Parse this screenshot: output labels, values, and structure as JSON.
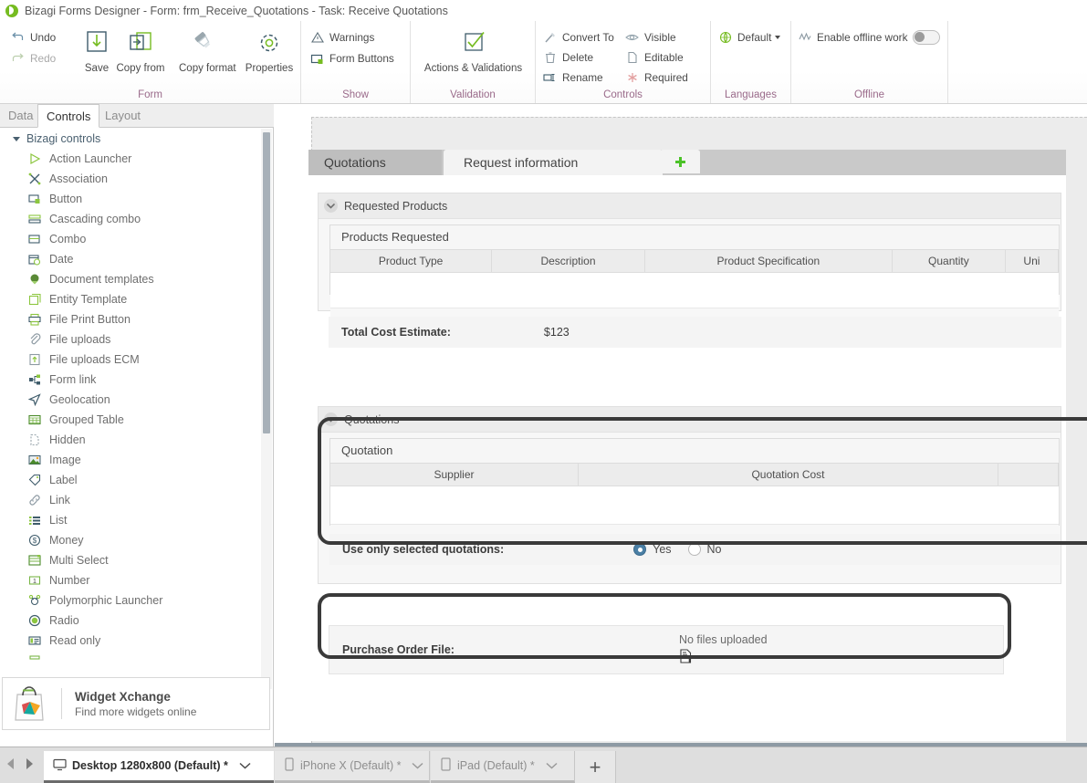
{
  "window": {
    "app_icon": "bizagi-logo-icon",
    "title": "Bizagi Forms Designer  - Form: frm_Receive_Quotations - Task:  Receive Quotations"
  },
  "ribbon": {
    "groups": [
      {
        "name": "Form",
        "title": "Form",
        "small_buttons": [
          {
            "label": "Undo",
            "icon": "undo-icon",
            "enabled": true
          },
          {
            "label": "Redo",
            "icon": "redo-icon",
            "enabled": false
          }
        ],
        "big_buttons": [
          {
            "label": "Save",
            "icon": "save-icon"
          },
          {
            "label": "Copy from",
            "icon": "copy-from-icon"
          },
          {
            "label": "Copy format",
            "icon": "copy-format-icon"
          },
          {
            "label": "Properties",
            "icon": "properties-gear-icon"
          }
        ]
      },
      {
        "name": "Show",
        "title": "Show",
        "small_buttons": [
          {
            "label": "Warnings",
            "icon": "warning-triangle-icon"
          },
          {
            "label": "Form Buttons",
            "icon": "form-buttons-icon"
          }
        ]
      },
      {
        "name": "Validation",
        "title": "Validation",
        "big_buttons": [
          {
            "label": "Actions & Validations",
            "icon": "checkmark-box-icon"
          }
        ]
      },
      {
        "name": "Controls",
        "title": "Controls",
        "small_buttons": [
          {
            "label": "Convert To",
            "icon": "convert-to-icon"
          },
          {
            "label": "Delete",
            "icon": "trash-icon"
          },
          {
            "label": "Rename",
            "icon": "rename-icon"
          }
        ],
        "small_buttons_2": [
          {
            "label": "Visible",
            "icon": "eye-icon"
          },
          {
            "label": "Editable",
            "icon": "editable-page-icon"
          },
          {
            "label": "Required",
            "icon": "required-asterisk-icon"
          }
        ]
      },
      {
        "name": "Languages",
        "title": "Languages",
        "dropdown": {
          "label": "Default",
          "icon": "globe-icon",
          "caret": "chevron-down-icon"
        }
      },
      {
        "name": "Offline",
        "title": "Offline",
        "toggle": {
          "label": "Enable offline work",
          "icon": "offline-icon",
          "state": "off"
        }
      }
    ]
  },
  "left_panel": {
    "tabs": [
      {
        "label": "Data",
        "active": false
      },
      {
        "label": "Controls",
        "active": true
      },
      {
        "label": "Layout",
        "active": false
      }
    ],
    "group_header": "Bizagi controls",
    "items": [
      {
        "label": "Action Launcher",
        "icon": "play-triangle-icon"
      },
      {
        "label": "Association",
        "icon": "association-icon"
      },
      {
        "label": "Button",
        "icon": "button-icon"
      },
      {
        "label": "Cascading combo",
        "icon": "cascading-combo-icon"
      },
      {
        "label": "Combo",
        "icon": "combo-icon"
      },
      {
        "label": "Date",
        "icon": "calendar-clock-icon"
      },
      {
        "label": "Document templates",
        "icon": "document-templates-icon"
      },
      {
        "label": "Entity Template",
        "icon": "entity-template-icon"
      },
      {
        "label": "File Print Button",
        "icon": "printer-icon"
      },
      {
        "label": "File uploads",
        "icon": "paperclip-icon"
      },
      {
        "label": "File uploads ECM",
        "icon": "upload-arrow-icon"
      },
      {
        "label": "Form link",
        "icon": "form-link-icon"
      },
      {
        "label": "Geolocation",
        "icon": "geolocation-arrow-icon"
      },
      {
        "label": "Grouped Table",
        "icon": "grouped-table-icon"
      },
      {
        "label": "Hidden",
        "icon": "hidden-page-icon"
      },
      {
        "label": "Image",
        "icon": "image-icon"
      },
      {
        "label": "Label",
        "icon": "tag-label-icon"
      },
      {
        "label": "Link",
        "icon": "link-chain-icon"
      },
      {
        "label": "List",
        "icon": "list-icon"
      },
      {
        "label": "Money",
        "icon": "money-dollar-icon"
      },
      {
        "label": "Multi Select",
        "icon": "multi-select-icon"
      },
      {
        "label": "Number",
        "icon": "number-icon"
      },
      {
        "label": "Polymorphic Launcher",
        "icon": "polymorphic-launcher-icon"
      },
      {
        "label": "Radio",
        "icon": "radio-icon"
      },
      {
        "label": "Read only",
        "icon": "read-only-icon"
      }
    ],
    "widget_promo": {
      "title": "Widget Xchange",
      "subtitle": "Find more widgets online",
      "icon": "widget-bag-icon"
    }
  },
  "form": {
    "tabs": [
      {
        "label": "Quotations",
        "selected": true
      },
      {
        "label": "Request information",
        "selected": false
      }
    ],
    "add_tab_icon": "add-plus-icon",
    "sections": [
      {
        "id": "requested-products",
        "header": "Requested Products",
        "collapse_icon": "chevron-down-icon",
        "grid": {
          "title": "Products Requested",
          "columns": [
            "Product Type",
            "Description",
            "Product Specification",
            "Quantity",
            "Uni"
          ],
          "rows": []
        },
        "total_row": {
          "label": "Total Cost Estimate:",
          "value": "$123"
        }
      },
      {
        "id": "quotations",
        "header": "Quotations",
        "collapse_icon": "chevron-down-icon",
        "grid": {
          "title": "Quotation",
          "columns": [
            "Supplier",
            "Quotation Cost",
            ""
          ],
          "rows": []
        },
        "radio_row": {
          "label": "Use only selected quotations:",
          "options": [
            {
              "label": "Yes",
              "selected": true
            },
            {
              "label": "No",
              "selected": false
            }
          ]
        }
      },
      {
        "id": "purchase-order-file",
        "field": {
          "label": "Purchase Order File:",
          "status": "No files uploaded",
          "icon": "file-upload-icon"
        }
      }
    ]
  },
  "device_bar": {
    "nav": {
      "prev_icon": "chevron-left-icon",
      "next_icon": "chevron-right-icon"
    },
    "tabs": [
      {
        "label": "Desktop 1280x800 (Default) *",
        "icon": "monitor-icon",
        "active": true,
        "caret": "chevron-down-icon"
      },
      {
        "label": "iPhone X (Default) *",
        "icon": "phone-icon",
        "active": false,
        "caret": "chevron-down-icon"
      },
      {
        "label": "iPad (Default) *",
        "icon": "tablet-icon",
        "active": false,
        "caret": "chevron-down-icon"
      }
    ],
    "add_label": "+"
  },
  "colors": {
    "brand_green": "#76bc21",
    "group_title": "#9a6a8a",
    "radio_selected": "#4a7fa5",
    "annotation": "#3a3a3a"
  }
}
